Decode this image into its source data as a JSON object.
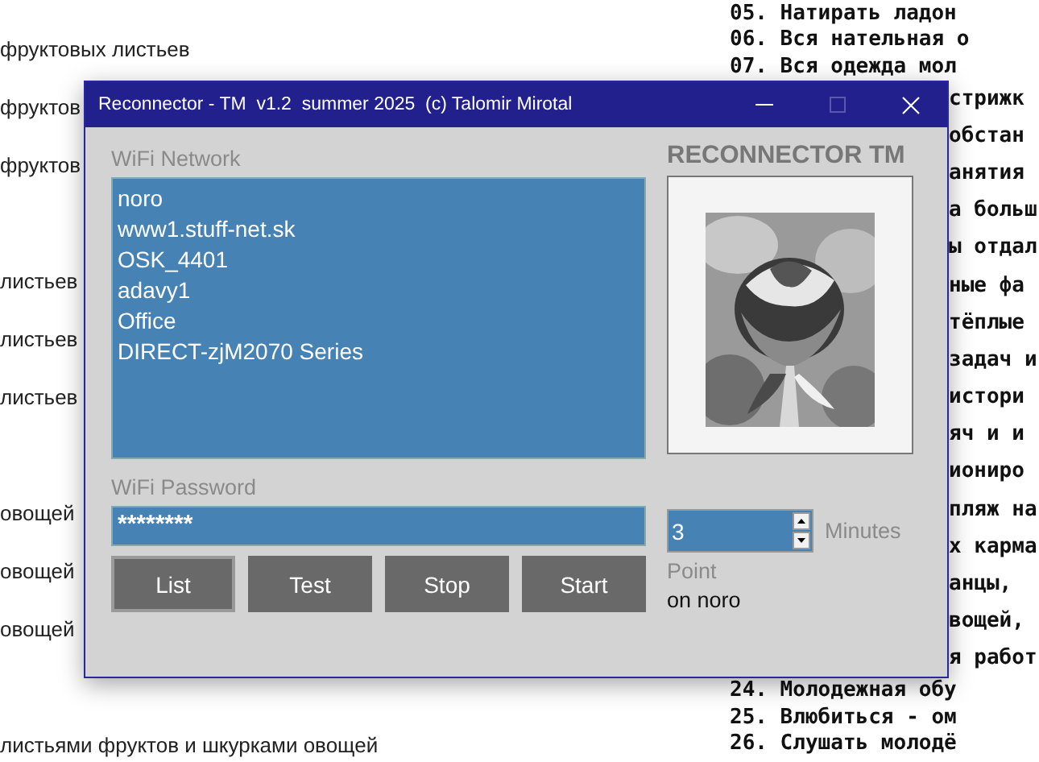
{
  "document": {
    "left_lines": [
      "фруктовых листьев",
      "фруктов",
      "фруктов",
      "листьев",
      "листьев",
      "листьев",
      "овощей",
      "овощей",
      "овощей",
      "листьями фруктов и шкурками овощей"
    ],
    "right_lines": [
      {
        "text": "05. Натирать ладон",
        "kind": "full"
      },
      {
        "text": "06. Вся нательная о",
        "kind": "full"
      },
      {
        "text": "07. Вся одежда мол",
        "kind": "full"
      },
      {
        "text": "стрижк",
        "kind": "partial"
      },
      {
        "text": "обстан",
        "kind": "partial"
      },
      {
        "text": "анятия",
        "kind": "partial"
      },
      {
        "text": "а больш",
        "kind": "partial"
      },
      {
        "text": "ы отдал",
        "kind": "partial"
      },
      {
        "text": "ные фа",
        "kind": "partial"
      },
      {
        "text": "тёплые",
        "kind": "partial"
      },
      {
        "text": "задач и",
        "kind": "partial"
      },
      {
        "text": "истори",
        "kind": "partial"
      },
      {
        "text": "яч и и",
        "kind": "partial"
      },
      {
        "text": "ионирo",
        "kind": "partial"
      },
      {
        "text": "пляж на",
        "kind": "partial"
      },
      {
        "text": "х карма",
        "kind": "partial"
      },
      {
        "text": "анцы,",
        "kind": "partial"
      },
      {
        "text": "вощей,",
        "kind": "partial"
      },
      {
        "text": "я работ",
        "kind": "partial"
      },
      {
        "text": "24. Молодежная обу",
        "kind": "full"
      },
      {
        "text": "25. Влюбиться - ом",
        "kind": "full"
      },
      {
        "text": "26. Слушать молодё",
        "kind": "full"
      }
    ]
  },
  "window": {
    "title": "Reconnector - TM  v1.2  summer 2025  (c) Talomir Mirotal"
  },
  "network": {
    "label": "WiFi Network",
    "items": [
      "noro",
      "www1.stuff-net.sk",
      "OSK_4401",
      "adavy1",
      "Office",
      "DIRECT-zjM2070 Series"
    ]
  },
  "password": {
    "label": "WiFi Password",
    "value": "********"
  },
  "buttons": [
    "List",
    "Test",
    "Stop",
    "Start"
  ],
  "brand": "RECONNECTOR TM",
  "timer": {
    "value": "3",
    "unit": "Minutes"
  },
  "point": {
    "label": "Point",
    "value": "on noro"
  }
}
